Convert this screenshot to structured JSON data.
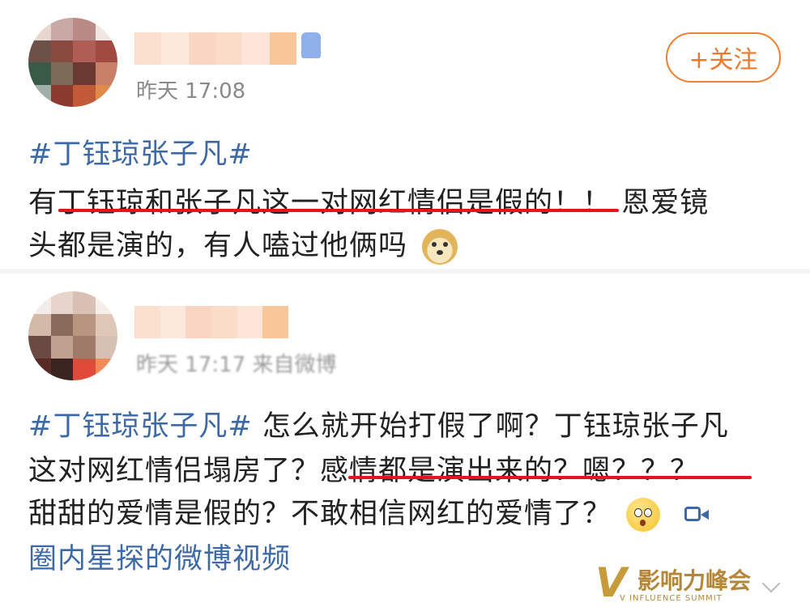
{
  "post1": {
    "time": "昨天 17:08",
    "follow_label": "+关注",
    "hashtag": "#丁钰琼张子凡#",
    "line1_a": "有",
    "line1_b": "丁钰琼和张子凡这一对网红情侣是假的！",
    "line1_c": "！ 恩爱镜",
    "line2": "头都是演的，有人嗑过他俩吗"
  },
  "post2": {
    "time": "昨天 17:17 来自微博",
    "hashtag": "#丁钰琼张子凡#",
    "line1": " 怎么就开始打假了啊？丁钰琼张子凡",
    "line2_a": "这对网红情侣塌房了？",
    "line2_b": "感情都是演出来的？嗯？？？",
    "line3": "甜甜的爱情是假的？不敢相信网红的爱情了？",
    "link": "圈内星探的微博视频",
    "badge_title": "影响力峰会",
    "badge_sub": "V INFLUENCE SUMMIT"
  },
  "colors": {
    "link": "#3d6aa6",
    "underline": "#e5131d",
    "follow": "#f0782a"
  }
}
